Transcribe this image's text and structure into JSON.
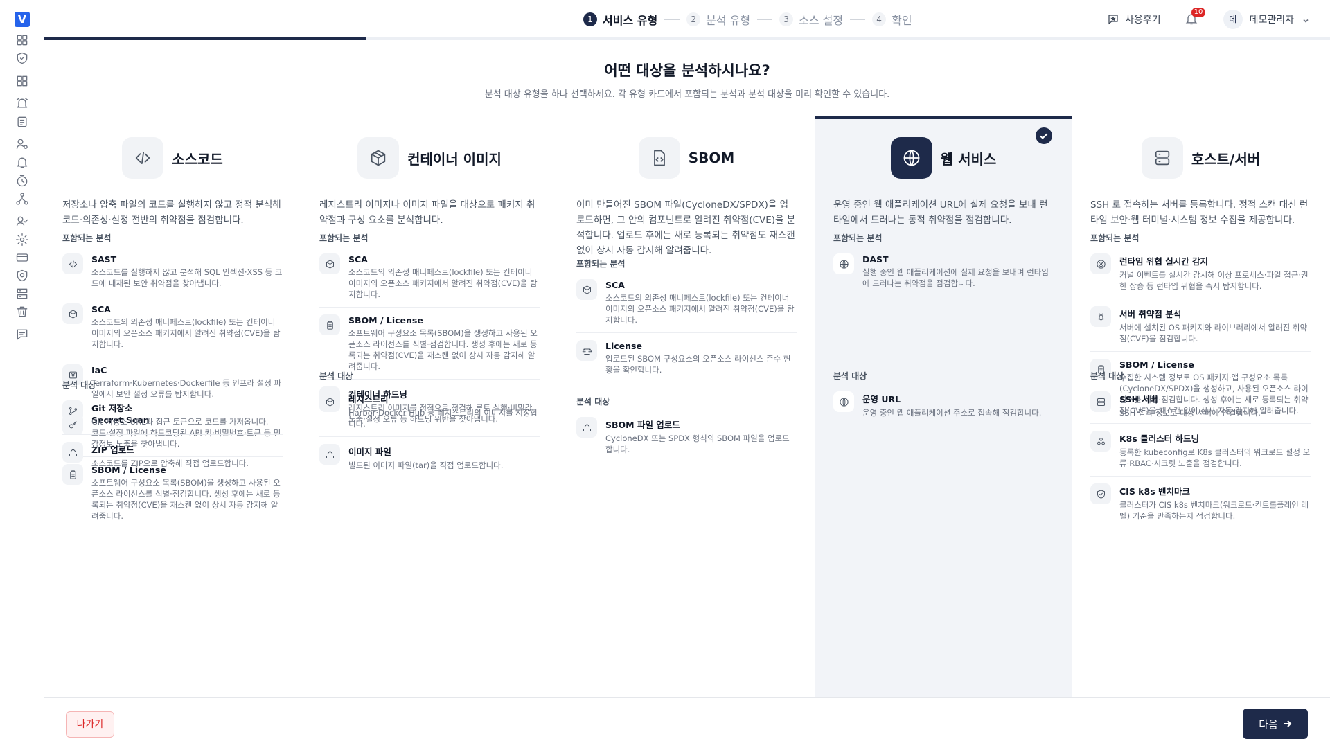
{
  "app": {
    "logo_letter": "V"
  },
  "sidebar": {
    "icons": [
      "dashboard-icon",
      "shield-check-icon",
      "grid-icon",
      "alarm-icon",
      "report-icon",
      "user-gear-icon",
      "bell-icon",
      "timer-icon",
      "network-icon",
      "user-check-icon",
      "settings-icon",
      "card-icon",
      "badge-icon",
      "server-list-icon",
      "trash-icon",
      "feedback-icon"
    ]
  },
  "steps": [
    {
      "num": "1",
      "label": "서비스 유형",
      "active": true
    },
    {
      "num": "2",
      "label": "분석 유형",
      "active": false
    },
    {
      "num": "3",
      "label": "소스 설정",
      "active": false
    },
    {
      "num": "4",
      "label": "확인",
      "active": false
    }
  ],
  "progress": {
    "fraction": 0.25
  },
  "topbar": {
    "feedback_label": "사용후기",
    "notification_count": "10",
    "avatar_initial": "데",
    "user_name": "데모관리자"
  },
  "header": {
    "title": "어떤 대상을 분석하시나요?",
    "subtitle": "분석 대상 유형을 하나 선택하세요. 각 유형 카드에서 포함되는 분석과 분석 대상을 미리 확인할 수 있습니다."
  },
  "labels": {
    "included": "포함되는 분석",
    "targets": "분석 대상"
  },
  "cards": [
    {
      "title": "소스코드",
      "icon": "code-icon",
      "selected": false,
      "desc": "저장소나 압축 파일의 코드를 실행하지 않고 정적 분석해 코드·의존성·설정 전반의 취약점을 점검합니다.",
      "analyses": [
        {
          "icon": "code-icon",
          "title": "SAST",
          "desc": "소스코드를 실행하지 않고 분석해 SQL 인젝션·XSS 등 코드에 내재된 보안 취약점을 찾아냅니다."
        },
        {
          "icon": "package-icon",
          "title": "SCA",
          "desc": "소스코드의 의존성 매니페스트(lockfile) 또는 컨테이너 이미지의 오픈소스 패키지에서 알려진 취약점(CVE)을 탐지합니다."
        },
        {
          "icon": "iac-icon",
          "title": "IaC",
          "desc": "Terraform·Kubernetes·Dockerfile 등 인프라 설정 파일에서 보안 설정 오류를 탐지합니다."
        },
        {
          "icon": "key-icon",
          "title": "Secret Scan",
          "desc": "코드·설정 파일에 하드코딩된 API 키·비밀번호·토큰 등 민감정보 노출을 찾아냅니다."
        },
        {
          "icon": "clipboard-icon",
          "title": "SBOM / License",
          "desc": "소프트웨어 구성요소 목록(SBOM)을 생성하고 사용된 오픈소스 라이선스를 식별·점검합니다. 생성 후에는 새로 등록되는 취약점(CVE)을 재스캔 없이 상시 자동 감지해 알려줍니다."
        }
      ],
      "targets": [
        {
          "icon": "git-icon",
          "title": "Git 저장소",
          "desc": "Git 저장소 URL과 접근 토큰으로 코드를 가져옵니다."
        },
        {
          "icon": "upload-icon",
          "title": "ZIP 업로드",
          "desc": "소스코드를 ZIP으로 압축해 직접 업로드합니다."
        }
      ]
    },
    {
      "title": "컨테이너 이미지",
      "icon": "box-icon",
      "selected": false,
      "desc": "레지스트리 이미지나 이미지 파일을 대상으로 패키지 취약점과 구성 요소를 분석합니다.",
      "analyses": [
        {
          "icon": "package-icon",
          "title": "SCA",
          "desc": "소스코드의 의존성 매니페스트(lockfile) 또는 컨테이너 이미지의 오픈소스 패키지에서 알려진 취약점(CVE)을 탐지합니다."
        },
        {
          "icon": "clipboard-icon",
          "title": "SBOM / License",
          "desc": "소프트웨어 구성요소 목록(SBOM)을 생성하고 사용된 오픈소스 라이선스를 식별·점검합니다. 생성 후에는 새로 등록되는 취약점(CVE)을 재스캔 없이 상시 자동 감지해 알려줍니다."
        },
        {
          "icon": "shield-icon",
          "title": "컨테이너 하드닝",
          "desc": "레지스트리 이미지를 정적으로 점검해 루트 실행·비밀값 노출·설정 오류 등 하드닝 위반을 찾아냅니다."
        }
      ],
      "targets": [
        {
          "icon": "package-icon",
          "title": "레지스트리",
          "desc": "Harbor·Docker Hub 등 레지스트리의 이미지를 지정합니다."
        },
        {
          "icon": "upload-icon",
          "title": "이미지 파일",
          "desc": "빌드된 이미지 파일(tar)을 직접 업로드합니다."
        }
      ]
    },
    {
      "title": "SBOM",
      "icon": "file-code-icon",
      "selected": false,
      "desc": "이미 만들어진 SBOM 파일(CycloneDX/SPDX)을 업로드하면, 그 안의 컴포넌트로 알려진 취약점(CVE)을 분석합니다. 업로드 후에는 새로 등록되는 취약점도 재스캔 없이 상시 자동 감지해 알려줍니다.",
      "analyses": [
        {
          "icon": "package-icon",
          "title": "SCA",
          "desc": "소스코드의 의존성 매니페스트(lockfile) 또는 컨테이너 이미지의 오픈소스 패키지에서 알려진 취약점(CVE)을 탐지합니다."
        },
        {
          "icon": "scale-icon",
          "title": "License",
          "desc": "업로드된 SBOM 구성요소의 오픈소스 라이선스 준수 현황을 확인합니다."
        }
      ],
      "targets": [
        {
          "icon": "upload-icon",
          "title": "SBOM 파일 업로드",
          "desc": "CycloneDX 또는 SPDX 형식의 SBOM 파일을 업로드합니다."
        }
      ]
    },
    {
      "title": "웹 서비스",
      "icon": "globe-icon",
      "selected": true,
      "desc": "운영 중인 웹 애플리케이션 URL에 실제 요청을 보내 런타임에서 드러나는 동적 취약점을 점검합니다.",
      "analyses": [
        {
          "icon": "globe-icon",
          "title": "DAST",
          "desc": "실행 중인 웹 애플리케이션에 실제 요청을 보내며 런타임에 드러나는 취약점을 점검합니다."
        }
      ],
      "targets": [
        {
          "icon": "globe-icon",
          "title": "운영 URL",
          "desc": "운영 중인 웹 애플리케이션 주소로 접속해 점검합니다."
        }
      ]
    },
    {
      "title": "호스트/서버",
      "icon": "server-icon",
      "selected": false,
      "desc": "SSH 로 접속하는 서버를 등록합니다. 정적 스캔 대신 런타임 보안·웹 터미널·시스템 정보 수집을 제공합니다.",
      "analyses": [
        {
          "icon": "radar-icon",
          "title": "런타임 위협 실시간 감지",
          "desc": "커널 이벤트를 실시간 감시해 이상 프로세스·파일 접근·권한 상승 등 런타임 위협을 즉시 탐지합니다."
        },
        {
          "icon": "bug-icon",
          "title": "서버 취약점 분석",
          "desc": "서버에 설치된 OS 패키지와 라이브러리에서 알려진 취약점(CVE)을 점검합니다."
        },
        {
          "icon": "clipboard-icon",
          "title": "SBOM / License",
          "desc": "수집한 시스템 정보로 OS 패키지·앱 구성요소 목록(CycloneDX/SPDX)을 생성하고, 사용된 오픈소스 라이선스를 식별·점검합니다. 생성 후에는 새로 등록되는 취약점(CVE)을 재스캔 없이 상시 자동 감지해 알려줍니다."
        },
        {
          "icon": "cluster-icon",
          "title": "K8s 클러스터 하드닝",
          "desc": "등록한 kubeconfig로 K8s 클러스터의 워크로드 설정 오류·RBAC·시크릿 노출을 점검합니다."
        },
        {
          "icon": "shield-icon",
          "title": "CIS k8s 벤치마크",
          "desc": "클러스터가 CIS k8s 벤치마크(워크로드·컨트롤플레인 레벨) 기준을 만족하는지 점검합니다."
        }
      ],
      "targets": [
        {
          "icon": "server-icon",
          "title": "SSH 서버",
          "desc": "SSH 접속 정보로 대상 서버에 연결합니다."
        }
      ]
    }
  ],
  "footer": {
    "exit_label": "나가기",
    "next_label": "다음"
  }
}
